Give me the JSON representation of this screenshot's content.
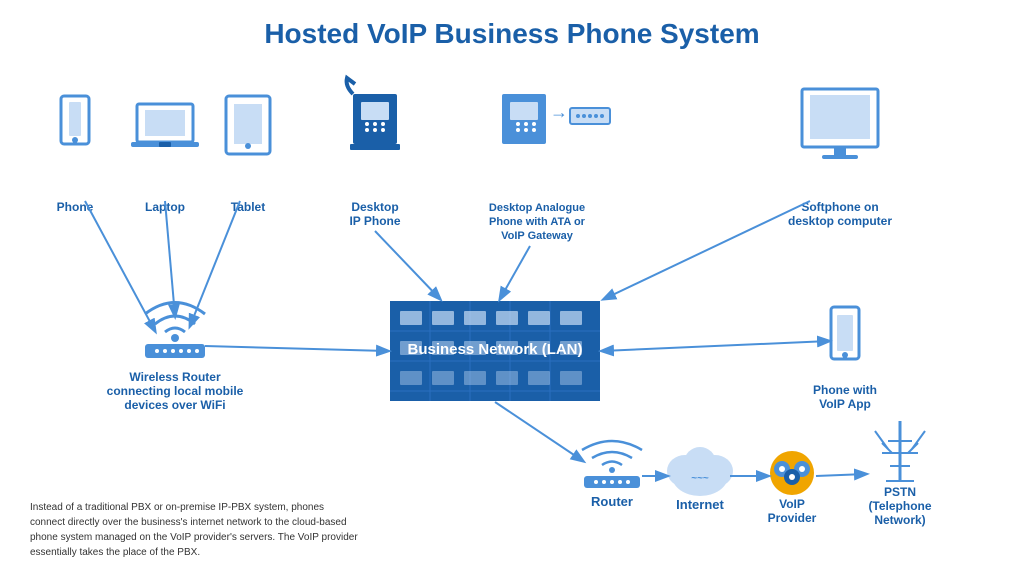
{
  "title": "Hosted VoIP Business Phone System",
  "devices": {
    "phone": "Phone",
    "laptop": "Laptop",
    "tablet": "Tablet",
    "desktop_ip": "Desktop\nIP Phone",
    "desktop_analogue": "Desktop Analogue\nPhone with ATA or\nVoIP Gateway",
    "softphone": "Softphone on\ndesktop computer",
    "wireless_router": "Wireless Router\nconnecting local mobile\ndevices over WiFi",
    "phone_voip": "Phone with\nVoIP App",
    "router": "Router",
    "internet": "Internet",
    "voip_provider": "VoIP\nProvider",
    "pstn": "PSTN\n(Telephone\nNetwork)",
    "business_network": "Business Network (LAN)"
  },
  "info_text": "Instead of a traditional PBX or on-premise IP-PBX system, phones connect directly over the business's internet network to the cloud-based phone system managed on the VoIP provider's servers. The VoIP provider essentially takes the place of the PBX.",
  "colors": {
    "blue": "#1a5fa8",
    "light_blue": "#4a90d9",
    "dark_blue": "#0d3d6e",
    "bg": "#ffffff",
    "icon_fill": "#4a90d9",
    "biz_network_bg": "#1a5fa8"
  }
}
